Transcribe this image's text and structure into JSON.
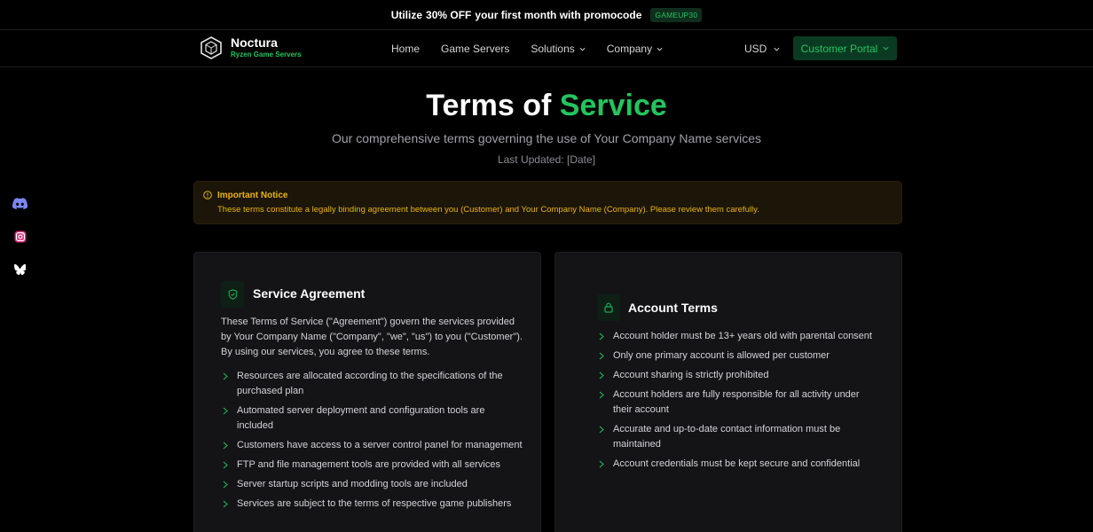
{
  "promo": {
    "prefix": "Utilize",
    "highlight": "30% OFF",
    "suffix": "your first month with promocode",
    "code": "GAMEUP30"
  },
  "brand": {
    "name": "Noctura",
    "tagline": "Ryzen Game Servers"
  },
  "nav": {
    "links": [
      {
        "label": "Home",
        "dropdown": false
      },
      {
        "label": "Game Servers",
        "dropdown": false
      },
      {
        "label": "Solutions",
        "dropdown": true
      },
      {
        "label": "Company",
        "dropdown": true
      }
    ],
    "currency": "USD",
    "portal_label": "Customer Portal"
  },
  "social": [
    "discord-icon",
    "instagram-icon",
    "bluesky-icon"
  ],
  "hero": {
    "title_plain": "Terms of",
    "title_accent": "Service",
    "subtitle": "Our comprehensive terms governing the use of Your Company Name services",
    "updated": "Last Updated: [Date]"
  },
  "notice": {
    "title": "Important Notice",
    "text": "These terms constitute a legally binding agreement between you (Customer) and Your Company Name (Company). Please review them carefully."
  },
  "service_agreement": {
    "title": "Service Agreement",
    "description": "These Terms of Service (\"Agreement\") govern the services provided by Your Company Name (\"Company\", \"we\", \"us\") to you (\"Customer\"). By using our services, you agree to these terms.",
    "items": [
      "Resources are allocated according to the specifications of the purchased plan",
      "Automated server deployment and configuration tools are included",
      "Customers have access to a server control panel for management",
      "FTP and file management tools are provided with all services",
      "Server startup scripts and modding tools are included",
      "Services are subject to the terms of respective game publishers"
    ]
  },
  "account_terms": {
    "title": "Account Terms",
    "items": [
      "Account holder must be 13+ years old with parental consent",
      "Only one primary account is allowed per customer",
      "Account sharing is strictly prohibited",
      "Account holders are fully responsible for all activity under their account",
      "Accurate and up-to-date contact information must be maintained",
      "Account credentials must be kept secure and confidential"
    ]
  },
  "colors": {
    "accent": "#22c55e",
    "warning": "#eab308",
    "card_bg": "#141417",
    "page_bg": "#000000"
  }
}
